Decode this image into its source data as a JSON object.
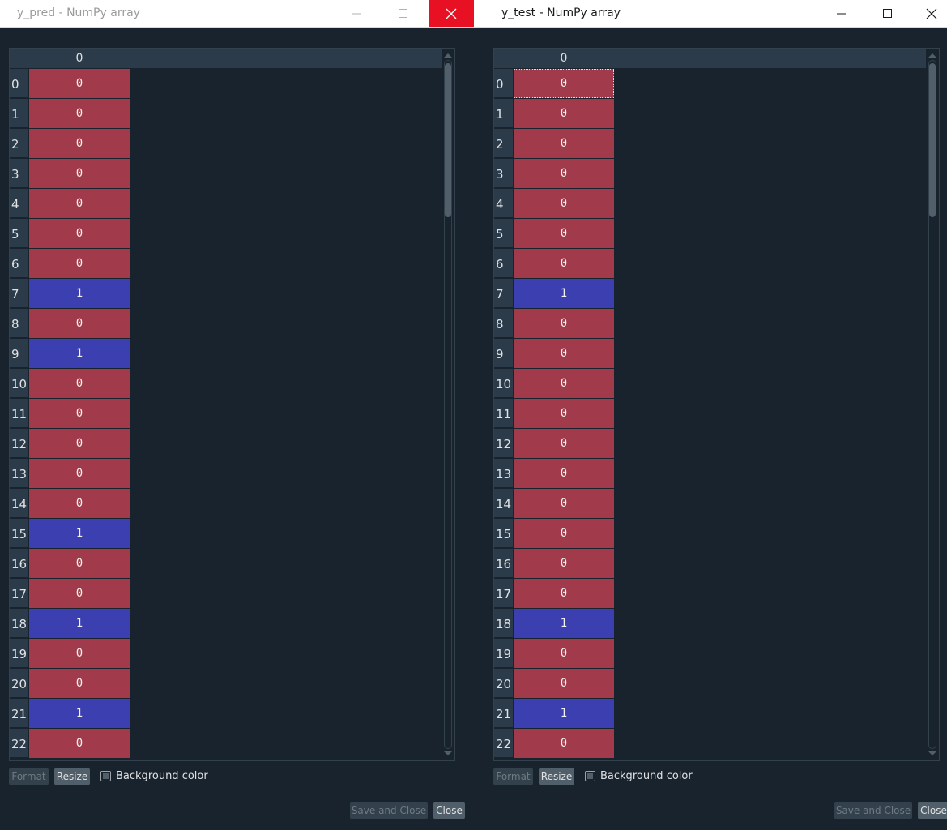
{
  "colors": {
    "zero": "#a13a4a",
    "one": "#3c3fb0"
  },
  "windows": [
    {
      "title": "y_pred - NumPy array",
      "column_header": "0",
      "row_labels": [
        "0",
        "1",
        "2",
        "3",
        "4",
        "5",
        "6",
        "7",
        "8",
        "9",
        "10",
        "11",
        "12",
        "13",
        "14",
        "15",
        "16",
        "17",
        "18",
        "19",
        "20",
        "21",
        "22"
      ],
      "values": [
        "0",
        "0",
        "0",
        "0",
        "0",
        "0",
        "0",
        "1",
        "0",
        "1",
        "0",
        "0",
        "0",
        "0",
        "0",
        "1",
        "0",
        "0",
        "1",
        "0",
        "0",
        "1",
        "0"
      ],
      "buttons": {
        "format": "Format",
        "resize": "Resize",
        "save_and_close": "Save and Close",
        "close": "Close"
      },
      "checkbox_label": "Background color"
    },
    {
      "title": "y_test - NumPy array",
      "column_header": "0",
      "row_labels": [
        "0",
        "1",
        "2",
        "3",
        "4",
        "5",
        "6",
        "7",
        "8",
        "9",
        "10",
        "11",
        "12",
        "13",
        "14",
        "15",
        "16",
        "17",
        "18",
        "19",
        "20",
        "21",
        "22"
      ],
      "values": [
        "0",
        "0",
        "0",
        "0",
        "0",
        "0",
        "0",
        "1",
        "0",
        "0",
        "0",
        "0",
        "0",
        "0",
        "0",
        "0",
        "0",
        "0",
        "1",
        "0",
        "0",
        "1",
        "0"
      ],
      "buttons": {
        "format": "Format",
        "resize": "Resize",
        "save_and_close": "Save and Close",
        "close": "Close"
      },
      "checkbox_label": "Background color"
    }
  ]
}
